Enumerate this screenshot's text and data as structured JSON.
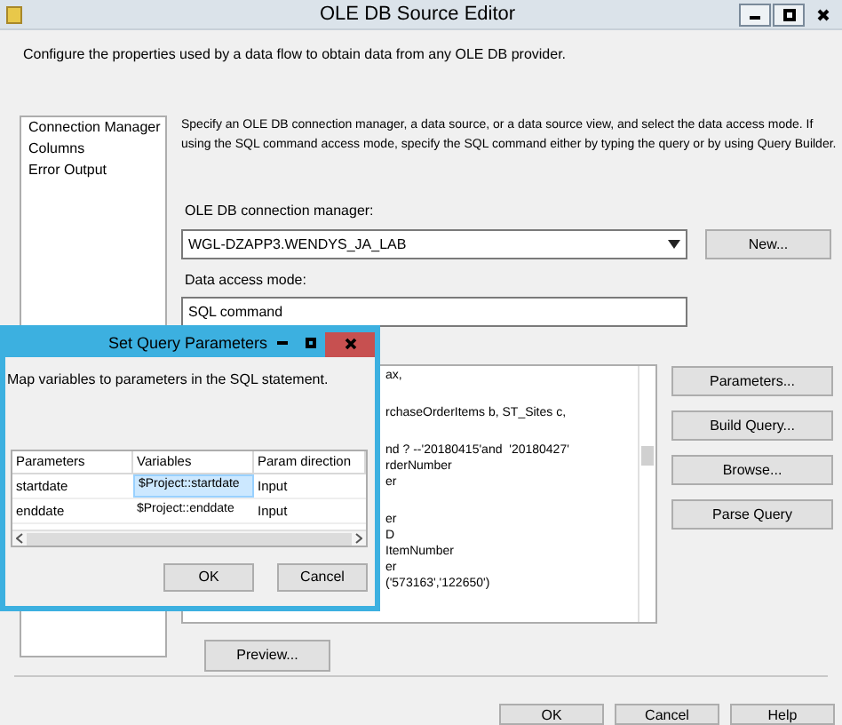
{
  "window": {
    "title": "OLE DB Source Editor",
    "description": "Configure the properties used by a data flow to obtain data from any OLE DB provider."
  },
  "nav": [
    {
      "label": "Connection Manager"
    },
    {
      "label": "Columns"
    },
    {
      "label": "Error Output"
    }
  ],
  "intro": "Specify an OLE DB connection manager, a data source, or a data source view, and select the data access mode. If using the SQL command access mode, specify the SQL command either by typing the query or by using Query Builder.",
  "connection_manager": {
    "label": "OLE DB connection manager:",
    "value": "WGL-DZAPP3.WENDYS_JA_LAB",
    "button": "New..."
  },
  "access_mode": {
    "label": "Data access mode:",
    "value": "SQL command"
  },
  "sql_blocks": [
    [
      "ax,"
    ],
    [
      "rchaseOrderItems b, ST_Sites c,"
    ],
    [
      "nd ? --'20180415'and  '20180427'",
      "rderNumber",
      "er"
    ],
    [
      "er",
      "D",
      "ItemNumber",
      "er",
      "('573163','122650')"
    ]
  ],
  "side_buttons": [
    "Parameters...",
    "Build Query...",
    "Browse...",
    "Parse Query"
  ],
  "preview_button": "Preview...",
  "footer_buttons": [
    "OK",
    "Cancel",
    "Help"
  ],
  "dialog": {
    "title": "Set Query Parameters",
    "description": "Map variables to parameters in the SQL statement.",
    "columns": [
      "Parameters",
      "Variables",
      "Param direction"
    ],
    "rows": [
      {
        "parameter": "startdate",
        "variable": "$Project::startdate",
        "direction": "Input",
        "selected": true
      },
      {
        "parameter": "enddate",
        "variable": "$Project::enddate",
        "direction": "Input",
        "selected": false
      }
    ],
    "buttons": [
      "OK",
      "Cancel"
    ]
  }
}
